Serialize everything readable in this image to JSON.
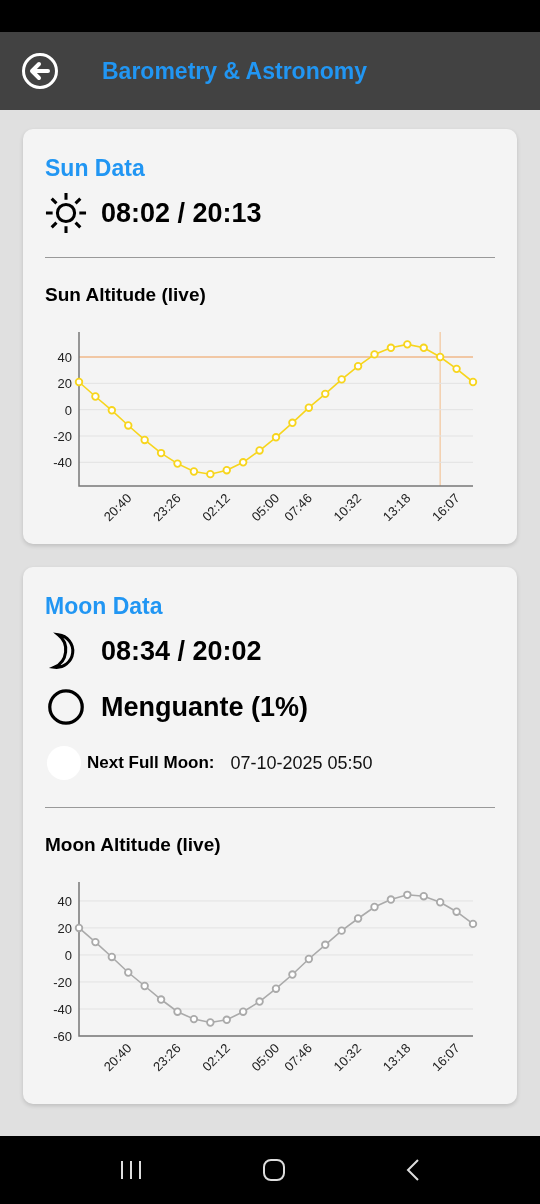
{
  "app_bar": {
    "title": "Barometry & Astronomy"
  },
  "sun": {
    "title": "Sun Data",
    "times": "08:02 / 20:13",
    "chart_title": "Sun Altitude (live)",
    "chart_data": {
      "type": "line",
      "categories": [
        null,
        null,
        null,
        "20:40",
        null,
        null,
        "23:26",
        null,
        null,
        "02:12",
        null,
        null,
        "05:00",
        null,
        "07:46",
        null,
        null,
        "10:32",
        null,
        null,
        "13:18",
        null,
        null,
        "16:07",
        null
      ],
      "grid": true,
      "series": [
        {
          "color": "#f7d51d",
          "marker": true,
          "values": [
            21,
            10,
            -0.5,
            -12,
            -23,
            -33,
            -41,
            -47,
            -49,
            -46,
            -40,
            -31,
            -21,
            -10,
            1.5,
            12,
            23,
            33,
            42,
            47,
            49.6,
            47,
            40,
            31,
            21
          ]
        }
      ],
      "ylim": [
        -58,
        59
      ],
      "yticks": [
        -40,
        -20,
        0,
        20,
        40
      ],
      "ref_lines": [
        {
          "axis": "y",
          "value": 40
        }
      ]
    }
  },
  "moon": {
    "title": "Moon Data",
    "times": "08:34 / 20:02",
    "phase": "Menguante (1%)",
    "next_full_moon": {
      "label": "Next Full Moon:",
      "value": "07-10-2025 05:50"
    },
    "chart_title": "Moon Altitude (live)",
    "chart_data": {
      "type": "line",
      "categories": [
        null,
        null,
        null,
        "20:40",
        null,
        null,
        "23:26",
        null,
        null,
        "02:12",
        null,
        null,
        "05:00",
        null,
        "07:46",
        null,
        null,
        "10:32",
        null,
        null,
        "13:18",
        null,
        null,
        "16:07",
        null
      ],
      "grid": true,
      "series": [
        {
          "color": "#aaaaaa",
          "marker": true,
          "values": [
            20,
            9.5,
            -1.5,
            -13,
            -23,
            -33,
            -42,
            -47.5,
            -50,
            -48,
            -42,
            -34.5,
            -25,
            -14.5,
            -3,
            7.5,
            18,
            27,
            35.5,
            41,
            44.5,
            43.5,
            39,
            32,
            23
          ]
        }
      ],
      "ylim": [
        -60,
        54
      ],
      "yticks": [
        -60,
        -40,
        -20,
        0,
        20,
        40
      ]
    }
  }
}
